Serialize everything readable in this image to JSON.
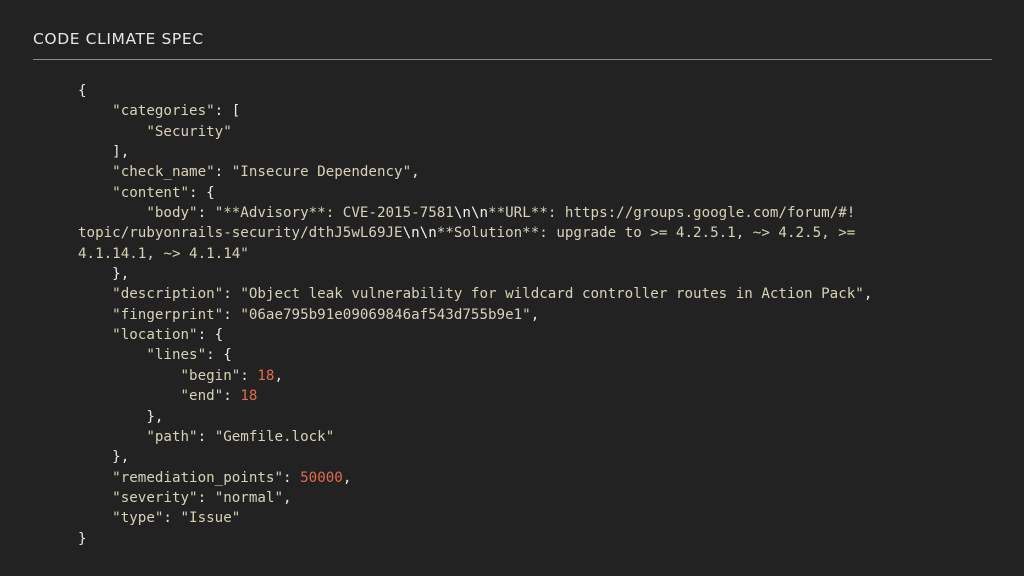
{
  "header": {
    "title": "CODE CLIMATE SPEC"
  },
  "code": {
    "lines": [
      [
        {
          "t": "p",
          "v": "{"
        }
      ],
      [
        {
          "t": "p",
          "v": "    "
        },
        {
          "t": "s",
          "v": "\"categories\""
        },
        {
          "t": "p",
          "v": ": ["
        }
      ],
      [
        {
          "t": "p",
          "v": "        "
        },
        {
          "t": "s",
          "v": "\"Security\""
        }
      ],
      [
        {
          "t": "p",
          "v": "    ],"
        }
      ],
      [
        {
          "t": "p",
          "v": "    "
        },
        {
          "t": "s",
          "v": "\"check_name\""
        },
        {
          "t": "p",
          "v": ": "
        },
        {
          "t": "s",
          "v": "\"Insecure Dependency\""
        },
        {
          "t": "p",
          "v": ","
        }
      ],
      [
        {
          "t": "p",
          "v": "    "
        },
        {
          "t": "s",
          "v": "\"content\""
        },
        {
          "t": "p",
          "v": ": {"
        }
      ],
      [
        {
          "t": "p",
          "v": "        "
        },
        {
          "t": "s",
          "v": "\"body\""
        },
        {
          "t": "p",
          "v": ": "
        },
        {
          "t": "s",
          "v": "\"**Advisory**: CVE-2015-7581"
        },
        {
          "t": "esc",
          "v": "\\n\\n"
        },
        {
          "t": "s",
          "v": "**URL**: https://groups.google.com/forum/#!"
        }
      ],
      [
        {
          "t": "s",
          "v": "topic/rubyonrails-security/dthJ5wL69JE"
        },
        {
          "t": "esc",
          "v": "\\n\\n"
        },
        {
          "t": "s",
          "v": "**Solution**: upgrade to >= 4.2.5.1, ~> 4.2.5, >="
        }
      ],
      [
        {
          "t": "s",
          "v": "4.1.14.1, ~> 4.1.14\""
        }
      ],
      [
        {
          "t": "p",
          "v": "    },"
        }
      ],
      [
        {
          "t": "p",
          "v": "    "
        },
        {
          "t": "s",
          "v": "\"description\""
        },
        {
          "t": "p",
          "v": ": "
        },
        {
          "t": "s",
          "v": "\"Object leak vulnerability for wildcard controller routes in Action Pack\""
        },
        {
          "t": "p",
          "v": ","
        }
      ],
      [
        {
          "t": "p",
          "v": "    "
        },
        {
          "t": "s",
          "v": "\"fingerprint\""
        },
        {
          "t": "p",
          "v": ": "
        },
        {
          "t": "s",
          "v": "\"06ae795b91e09069846af543d755b9e1\""
        },
        {
          "t": "p",
          "v": ","
        }
      ],
      [
        {
          "t": "p",
          "v": "    "
        },
        {
          "t": "s",
          "v": "\"location\""
        },
        {
          "t": "p",
          "v": ": {"
        }
      ],
      [
        {
          "t": "p",
          "v": "        "
        },
        {
          "t": "s",
          "v": "\"lines\""
        },
        {
          "t": "p",
          "v": ": {"
        }
      ],
      [
        {
          "t": "p",
          "v": "            "
        },
        {
          "t": "s",
          "v": "\"begin\""
        },
        {
          "t": "p",
          "v": ": "
        },
        {
          "t": "n",
          "v": "18"
        },
        {
          "t": "p",
          "v": ","
        }
      ],
      [
        {
          "t": "p",
          "v": "            "
        },
        {
          "t": "s",
          "v": "\"end\""
        },
        {
          "t": "p",
          "v": ": "
        },
        {
          "t": "n",
          "v": "18"
        }
      ],
      [
        {
          "t": "p",
          "v": "        },"
        }
      ],
      [
        {
          "t": "p",
          "v": "        "
        },
        {
          "t": "s",
          "v": "\"path\""
        },
        {
          "t": "p",
          "v": ": "
        },
        {
          "t": "s",
          "v": "\"Gemfile.lock\""
        }
      ],
      [
        {
          "t": "p",
          "v": "    },"
        }
      ],
      [
        {
          "t": "p",
          "v": "    "
        },
        {
          "t": "s",
          "v": "\"remediation_points\""
        },
        {
          "t": "p",
          "v": ": "
        },
        {
          "t": "n",
          "v": "50000"
        },
        {
          "t": "p",
          "v": ","
        }
      ],
      [
        {
          "t": "p",
          "v": "    "
        },
        {
          "t": "s",
          "v": "\"severity\""
        },
        {
          "t": "p",
          "v": ": "
        },
        {
          "t": "s",
          "v": "\"normal\""
        },
        {
          "t": "p",
          "v": ","
        }
      ],
      [
        {
          "t": "p",
          "v": "    "
        },
        {
          "t": "s",
          "v": "\"type\""
        },
        {
          "t": "p",
          "v": ": "
        },
        {
          "t": "s",
          "v": "\"Issue\""
        }
      ],
      [
        {
          "t": "p",
          "v": "}"
        }
      ]
    ]
  },
  "colors": {
    "background": "#222222",
    "string": "#d8d2b8",
    "number": "#e06c4c",
    "punctuation": "#e8e8e8",
    "rule": "#8a8a8a"
  }
}
